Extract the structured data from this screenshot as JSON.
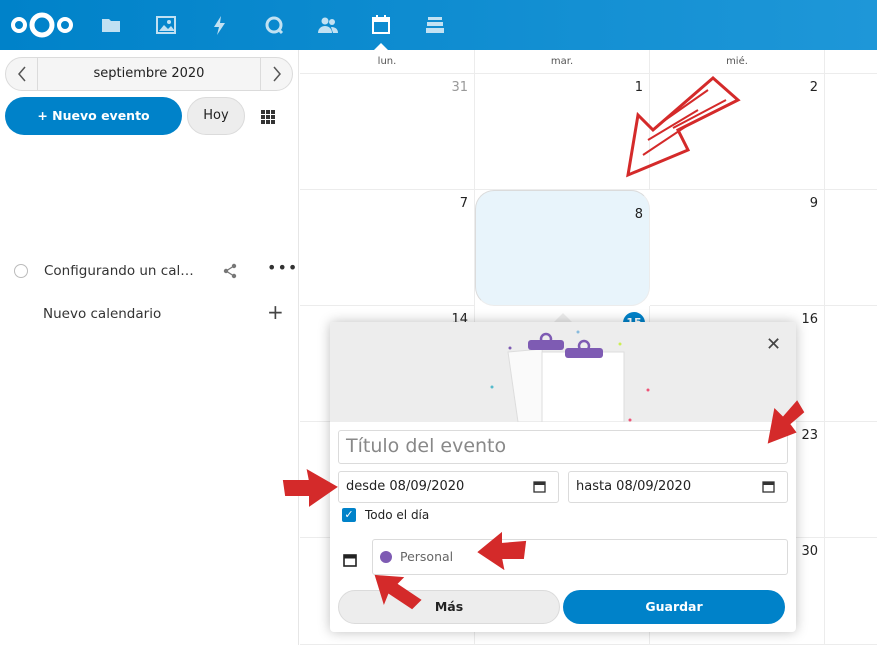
{
  "header": {
    "apps": [
      {
        "name": "files-icon"
      },
      {
        "name": "photos-icon"
      },
      {
        "name": "activity-icon"
      },
      {
        "name": "search-icon"
      },
      {
        "name": "contacts-icon"
      },
      {
        "name": "calendar-icon"
      },
      {
        "name": "deck-icon"
      }
    ]
  },
  "sidebar": {
    "month_label": "septiembre 2020",
    "new_event_label": "+ Nuevo evento",
    "today_label": "Hoy",
    "calendar_name": "Configurando un cal…",
    "new_calendar_label": "Nuevo calendario"
  },
  "calendar": {
    "day_headers": [
      "lun.",
      "mar.",
      "mié."
    ],
    "week1": [
      "31",
      "1",
      "2"
    ],
    "week2": [
      "7",
      "8",
      "9"
    ],
    "week3": [
      "14",
      "15",
      "16"
    ],
    "week4": [
      "23"
    ],
    "week5": [
      "30"
    ]
  },
  "popover": {
    "title_placeholder": "Título del evento",
    "from_date": "desde 08/09/2020",
    "to_date": "hasta 08/09/2020",
    "all_day_label": "Todo el día",
    "calendar_choice": "Personal",
    "more_label": "Más",
    "save_label": "Guardar"
  },
  "colors": {
    "brand": "#0082c9",
    "calendar_dot": "#7e5bb3",
    "annotation": "#d42a2a"
  }
}
